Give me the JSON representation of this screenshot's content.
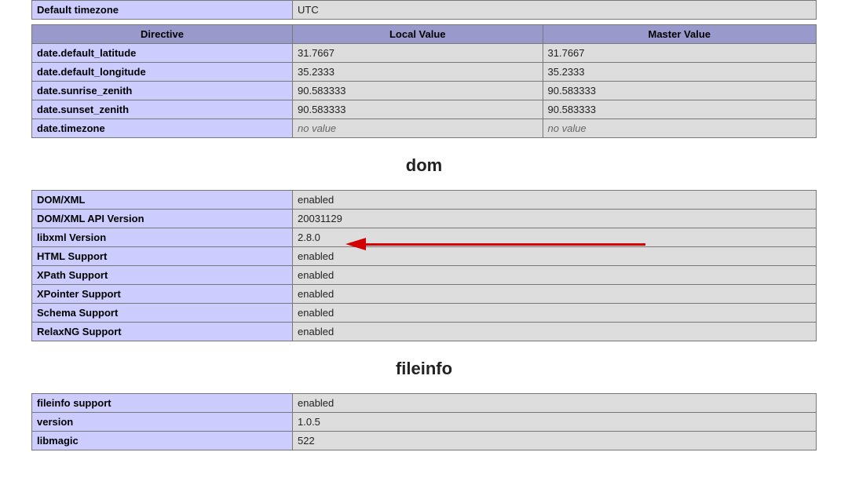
{
  "topInfo": {
    "default_timezone_label": "Default timezone",
    "default_timezone_value": "UTC"
  },
  "directives_table": {
    "headers": {
      "directive": "Directive",
      "local": "Local Value",
      "master": "Master Value"
    },
    "rows": [
      {
        "name": "date.default_latitude",
        "local": "31.7667",
        "master": "31.7667"
      },
      {
        "name": "date.default_longitude",
        "local": "35.2333",
        "master": "35.2333"
      },
      {
        "name": "date.sunrise_zenith",
        "local": "90.583333",
        "master": "90.583333"
      },
      {
        "name": "date.sunset_zenith",
        "local": "90.583333",
        "master": "90.583333"
      },
      {
        "name": "date.timezone",
        "local": "no value",
        "master": "no value",
        "novalue": true
      }
    ]
  },
  "sections": {
    "dom": {
      "title": "dom",
      "rows": [
        {
          "name": "DOM/XML",
          "value": "enabled"
        },
        {
          "name": "DOM/XML API Version",
          "value": "20031129"
        },
        {
          "name": "libxml Version",
          "value": "2.8.0"
        },
        {
          "name": "HTML Support",
          "value": "enabled"
        },
        {
          "name": "XPath Support",
          "value": "enabled"
        },
        {
          "name": "XPointer Support",
          "value": "enabled"
        },
        {
          "name": "Schema Support",
          "value": "enabled"
        },
        {
          "name": "RelaxNG Support",
          "value": "enabled"
        }
      ]
    },
    "fileinfo": {
      "title": "fileinfo",
      "rows": [
        {
          "name": "fileinfo support",
          "value": "enabled"
        },
        {
          "name": "version",
          "value": "1.0.5"
        },
        {
          "name": "libmagic",
          "value": "522"
        }
      ]
    }
  },
  "arrow": {
    "points_to": "libxml Version"
  }
}
